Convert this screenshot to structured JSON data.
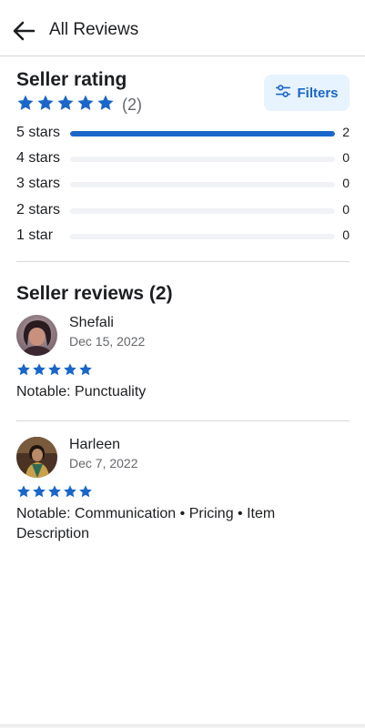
{
  "header": {
    "title": "All Reviews"
  },
  "rating": {
    "title": "Seller rating",
    "stars": 5,
    "count": "(2)",
    "filters_label": "Filters",
    "distribution": [
      {
        "label": "5 stars",
        "count": "2",
        "fraction": 1.0
      },
      {
        "label": "4 stars",
        "count": "0",
        "fraction": 0
      },
      {
        "label": "3 stars",
        "count": "0",
        "fraction": 0
      },
      {
        "label": "2 stars",
        "count": "0",
        "fraction": 0
      },
      {
        "label": "1 star",
        "count": "0",
        "fraction": 0
      }
    ]
  },
  "reviews": {
    "title": "Seller reviews (2)",
    "items": [
      {
        "name": "Shefali",
        "date": "Dec 15, 2022",
        "stars": 5,
        "text": "Notable: Punctuality"
      },
      {
        "name": "Harleen",
        "date": "Dec 7, 2022",
        "stars": 5,
        "text": "Notable: Communication • Pricing • Item Description"
      }
    ]
  },
  "colors": {
    "accent": "#1a66c9",
    "track": "#f0f2f5",
    "divider": "#d6d8db",
    "muted": "#65676b"
  }
}
